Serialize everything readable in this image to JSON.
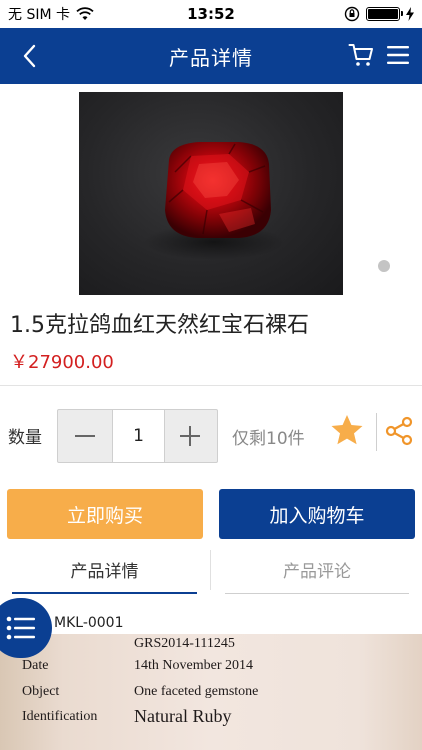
{
  "status_bar": {
    "carrier": "无 SIM 卡",
    "time": "13:52"
  },
  "nav": {
    "title": "产品详情"
  },
  "product": {
    "title": "1.5克拉鸽血红天然红宝石裸石",
    "price": "￥27900.00"
  },
  "quantity": {
    "label": "数量",
    "value": "1",
    "stock": "仅剩10件"
  },
  "actions": {
    "buy_now": "立即购买",
    "add_to_cart": "加入购物车"
  },
  "tabs": [
    {
      "label": "产品详情",
      "active": true
    },
    {
      "label": "产品评论",
      "active": false
    }
  ],
  "detail": {
    "sku": "MKL-0001",
    "certificate": [
      {
        "label": "",
        "value": "GRS2014-111245"
      },
      {
        "label": "Date",
        "value": "14th November 2014"
      },
      {
        "label": "Object",
        "value": "One faceted gemstone"
      },
      {
        "label": "Identification",
        "value": "Natural Ruby"
      }
    ]
  },
  "colors": {
    "brand_blue": "#0b3f92",
    "buy_orange": "#f7ad4a",
    "price_red": "#d32020",
    "star_orange": "#f7ad4a"
  },
  "icons": {
    "back": "chevron-left-icon",
    "cart": "cart-icon",
    "menu": "hamburger-icon",
    "favorite": "star-icon",
    "share": "share-icon",
    "float_menu": "list-icon"
  }
}
